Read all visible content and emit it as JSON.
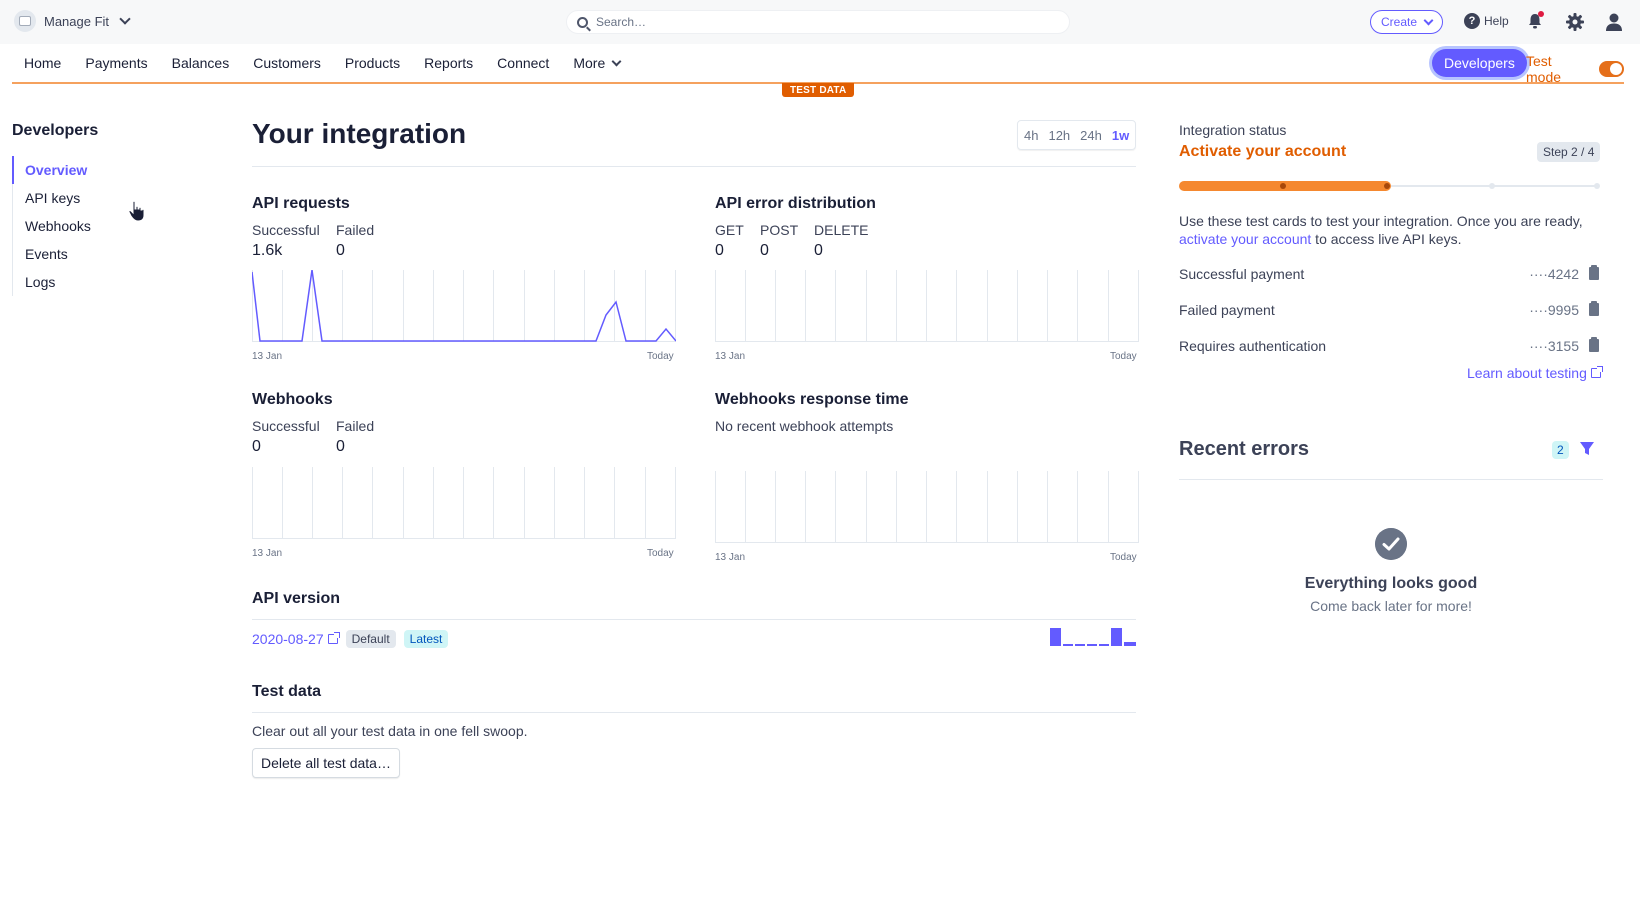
{
  "account": {
    "name": "Manage Fit"
  },
  "search": {
    "placeholder": "Search…"
  },
  "topbar": {
    "create_label": "Create",
    "help_label": "Help"
  },
  "nav": {
    "items": [
      "Home",
      "Payments",
      "Balances",
      "Customers",
      "Products",
      "Reports",
      "Connect",
      "More"
    ],
    "developers_label": "Developers",
    "test_mode_label": "Test mode",
    "test_data_badge": "TEST DATA"
  },
  "sidebar": {
    "title": "Developers",
    "items": [
      "Overview",
      "API keys",
      "Webhooks",
      "Events",
      "Logs"
    ],
    "active": "Overview"
  },
  "main": {
    "title": "Your integration",
    "time_ranges": [
      "4h",
      "12h",
      "24h",
      "1w"
    ],
    "selected_range": "1w",
    "api_requests": {
      "title": "API requests",
      "metrics": [
        {
          "label": "Successful",
          "value": "1.6k"
        },
        {
          "label": "Failed",
          "value": "0"
        }
      ],
      "x_start": "13 Jan",
      "x_end": "Today"
    },
    "api_errors": {
      "title": "API error distribution",
      "metrics": [
        {
          "label": "GET",
          "value": "0"
        },
        {
          "label": "POST",
          "value": "0"
        },
        {
          "label": "DELETE",
          "value": "0"
        }
      ],
      "x_start": "13 Jan",
      "x_end": "Today"
    },
    "webhooks": {
      "title": "Webhooks",
      "metrics": [
        {
          "label": "Successful",
          "value": "0"
        },
        {
          "label": "Failed",
          "value": "0"
        }
      ],
      "x_start": "13 Jan",
      "x_end": "Today"
    },
    "webhooks_response": {
      "title": "Webhooks response time",
      "note": "No recent webhook attempts",
      "x_start": "13 Jan",
      "x_end": "Today"
    },
    "api_version": {
      "title": "API version",
      "version": "2020-08-27",
      "badges": [
        "Default",
        "Latest"
      ]
    },
    "test_data": {
      "title": "Test data",
      "description": "Clear out all your test data in one fell swoop.",
      "button": "Delete all test data…"
    }
  },
  "right": {
    "status_label": "Integration status",
    "status_value": "Activate your account",
    "step": "Step 2 / 4",
    "progress_fraction": 0.5,
    "description_pre": "Use these test cards to test your integration. Once you are ready, ",
    "description_link": "activate your account",
    "description_post": " to access live API keys.",
    "cards": [
      {
        "label": "Successful payment",
        "number": "····4242"
      },
      {
        "label": "Failed payment",
        "number": "····9995"
      },
      {
        "label": "Requires authentication",
        "number": "····3155"
      }
    ],
    "learn_link": "Learn about testing",
    "recent_errors": {
      "title": "Recent errors",
      "count": "2",
      "ok_title": "Everything looks good",
      "ok_sub": "Come back later for more!"
    }
  },
  "colors": {
    "accent": "#635bff",
    "test_orange": "#e05d00"
  }
}
